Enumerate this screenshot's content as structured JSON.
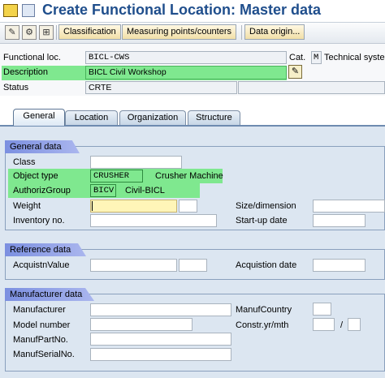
{
  "window": {
    "title": "Create Functional Location: Master data"
  },
  "toolbar": {
    "buttons": [
      "Classification",
      "Measuring points/counters",
      "Data origin..."
    ]
  },
  "header": {
    "functional_loc_label": "Functional loc.",
    "functional_loc_value": "BICL-CWS",
    "cat_label": "Cat.",
    "cat_value": "M",
    "cat_text": "Technical syste",
    "description_label": "Description",
    "description_value": "BICL Civil Workshop",
    "status_label": "Status",
    "status_value": "CRTE"
  },
  "tabs": [
    "General",
    "Location",
    "Organization",
    "Structure"
  ],
  "active_tab": "General",
  "general_data": {
    "title": "General data",
    "class_label": "Class",
    "class_value": "",
    "object_type_label": "Object type",
    "object_type_value": "CRUSHER",
    "object_type_text": "Crusher Machine",
    "authoriz_group_label": "AuthorizGroup",
    "authoriz_group_value": "BICV",
    "authoriz_group_text": "Civil-BICL",
    "weight_label": "Weight",
    "weight_value": "",
    "size_label": "Size/dimension",
    "inventory_label": "Inventory no.",
    "startup_label": "Start-up date"
  },
  "reference_data": {
    "title": "Reference data",
    "acquistn_value_label": "AcquistnValue",
    "acquistion_date_label": "Acquistion date"
  },
  "manufacturer_data": {
    "title": "Manufacturer data",
    "manufacturer_label": "Manufacturer",
    "manuf_country_label": "ManufCountry",
    "model_number_label": "Model number",
    "constr_label": "Constr.yr/mth",
    "constr_sep": "/",
    "manuf_part_label": "ManufPartNo.",
    "manuf_serial_label": "ManufSerialNo."
  },
  "colors": {
    "title": "#1f4e8c",
    "highlight": "#7fe88f",
    "group_title": "#7b8fe0",
    "panel": "#dce6f1"
  }
}
